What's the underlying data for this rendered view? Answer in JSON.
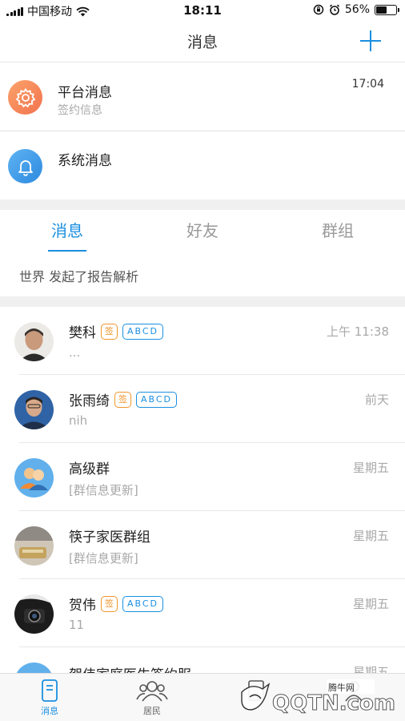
{
  "status_bar": {
    "carrier": "中国移动",
    "time": "18:11",
    "battery": "56%",
    "battery_level": 0.56
  },
  "header": {
    "title": "消息"
  },
  "system_rows": [
    {
      "title": "平台消息",
      "subtitle": "签约信息",
      "time": "17:04"
    },
    {
      "title": "系统消息"
    }
  ],
  "tabs": [
    {
      "label": "消息",
      "active": true
    },
    {
      "label": "好友"
    },
    {
      "label": "群组"
    }
  ],
  "notice": {
    "text": "世界 发起了报告解析"
  },
  "badges": {
    "sign": "签",
    "abcd": "ABCD"
  },
  "conversations": [
    {
      "name": "樊科",
      "message": "...",
      "time": "上午 11:38",
      "badges": true
    },
    {
      "name": "张雨绮",
      "message": "nih",
      "time": "前天",
      "badges": true
    },
    {
      "name": "高级群",
      "message": "[群信息更新]",
      "time": "星期五"
    },
    {
      "name": "筷子家医群组",
      "message": "[群信息更新]",
      "time": "星期五"
    },
    {
      "name": "贺伟",
      "message": "11",
      "time": "星期五",
      "badges": true
    },
    {
      "name": "贺伟家庭医生签约服",
      "time": "星期五"
    }
  ],
  "tab_bar": [
    {
      "label": "消息",
      "active": true
    },
    {
      "label": "居民"
    }
  ],
  "watermark": {
    "brand": "腾牛网",
    "text": "QQTN.com"
  },
  "colors": {
    "accent": "#1a8fe0",
    "orange": "#f0962d"
  }
}
